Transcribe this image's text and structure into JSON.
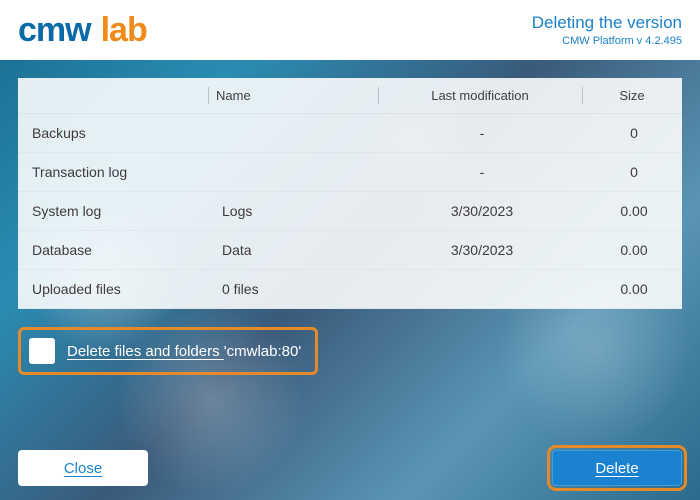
{
  "header": {
    "logo_cmw": "cmw",
    "logo_lab": "lab",
    "title": "Deleting the version",
    "version": "CMW Platform v 4.2.495"
  },
  "table": {
    "headers": {
      "category": "",
      "name": "Name",
      "last_mod": "Last modification",
      "size": "Size"
    },
    "rows": [
      {
        "category": "Backups",
        "name": "",
        "last_mod": "-",
        "size": "0"
      },
      {
        "category": "Transaction log",
        "name": "",
        "last_mod": "-",
        "size": "0"
      },
      {
        "category": "System log",
        "name": "Logs",
        "last_mod": "3/30/2023",
        "size": "0.00"
      },
      {
        "category": "Database",
        "name": "Data",
        "last_mod": "3/30/2023",
        "size": "0.00"
      },
      {
        "category": "Uploaded files",
        "name": "0 files",
        "last_mod": "",
        "size": "0.00"
      }
    ]
  },
  "checkbox": {
    "label_prefix": "Delete files and folders ",
    "instance": "'cmwlab:80'"
  },
  "buttons": {
    "close": "Close",
    "delete": "Delete"
  },
  "colors": {
    "accent_blue": "#1a82c8",
    "accent_orange": "#f08a1a",
    "highlight_orange": "#e58a2a"
  }
}
